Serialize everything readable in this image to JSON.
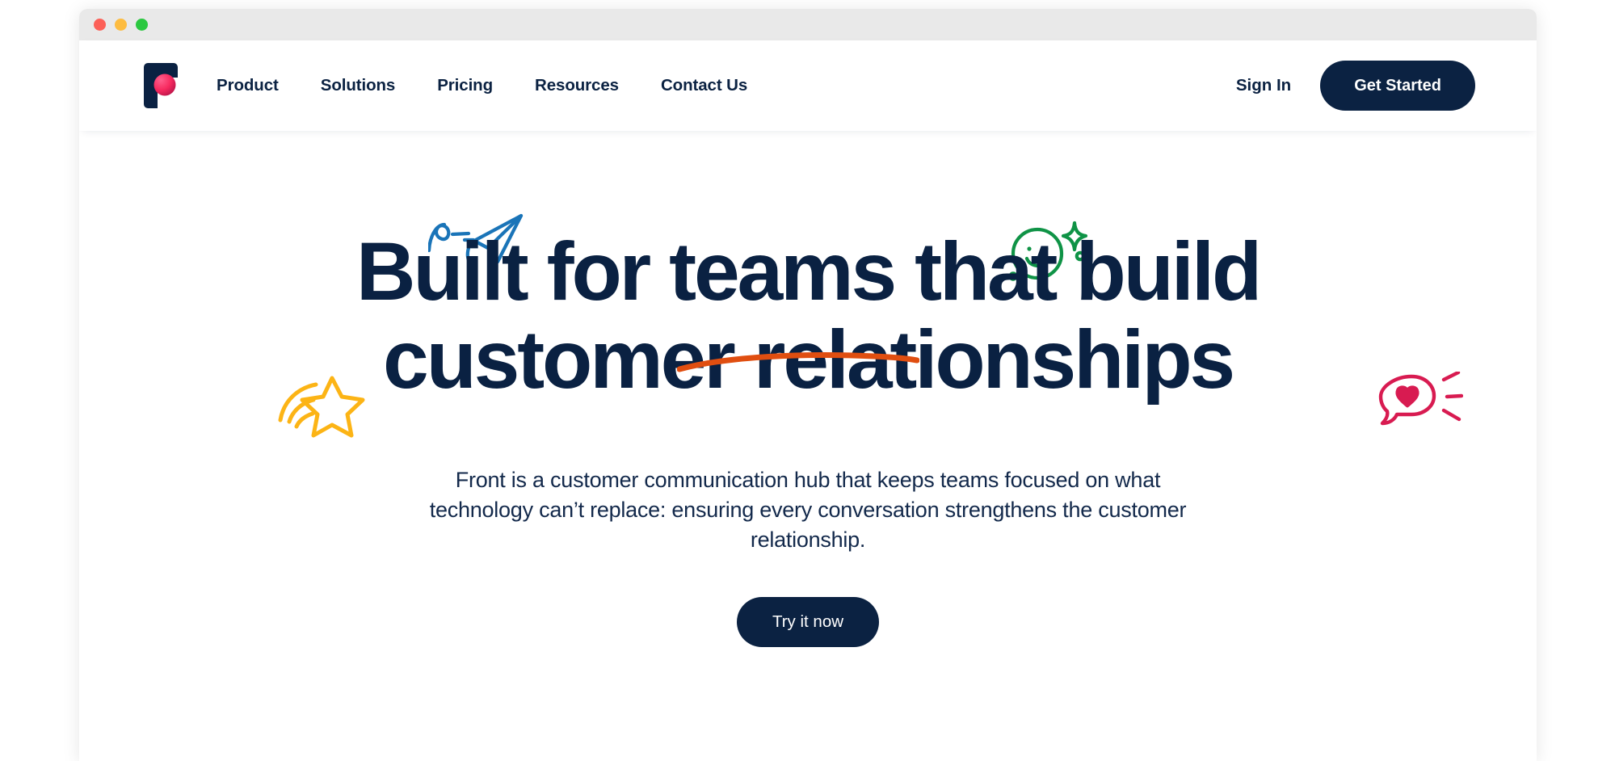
{
  "window": {
    "traffic_lights": [
      {
        "name": "close",
        "color": "#fc6058"
      },
      {
        "name": "minimize",
        "color": "#fdbc40"
      },
      {
        "name": "maximize",
        "color": "#2bc840"
      }
    ]
  },
  "header": {
    "logo_name": "front-logo",
    "nav": [
      {
        "label": "Product"
      },
      {
        "label": "Solutions"
      },
      {
        "label": "Pricing"
      },
      {
        "label": "Resources"
      },
      {
        "label": "Contact Us"
      }
    ],
    "sign_in_label": "Sign In",
    "get_started_label": "Get Started"
  },
  "hero": {
    "headline_line1": "Built for teams that build",
    "headline_line2": "customer relationships",
    "subhead": "Front is a customer communication hub that keeps teams focused on what technology can’t replace: ensuring every conversation strengthens the customer relationship.",
    "cta_label": "Try it now",
    "doodles": [
      {
        "name": "paper-plane-doodle",
        "color": "#1a74b8"
      },
      {
        "name": "smiley-face-doodle",
        "color": "#0f9346"
      },
      {
        "name": "shooting-star-doodle",
        "color": "#fcb415"
      },
      {
        "name": "heart-speech-bubble-doodle",
        "color": "#d81b51"
      },
      {
        "name": "orange-underline-doodle",
        "color": "#e04e10"
      }
    ]
  },
  "colors": {
    "navy": "#0a2142",
    "titlebar": "#e9e9e9",
    "page_bg": "#ffffff"
  }
}
